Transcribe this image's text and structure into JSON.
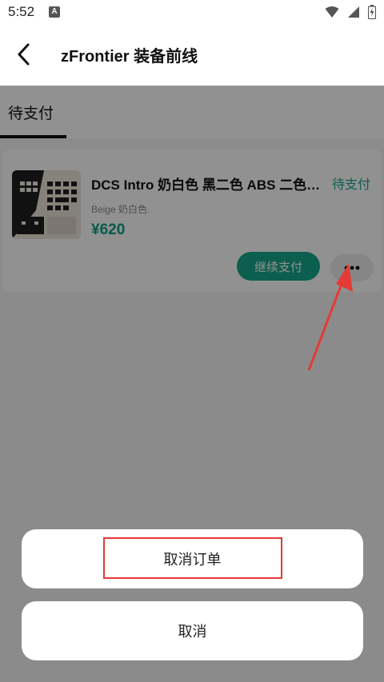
{
  "status_bar": {
    "time": "5:52",
    "notif_letter": "A"
  },
  "header": {
    "title": "zFrontier 装备前线"
  },
  "tabs": [
    {
      "label": "待支付",
      "active": true
    }
  ],
  "order": {
    "title": "DCS Intro 奶白色 黑二色 ABS 二色键帽",
    "status": "待支付",
    "variant": "Beige 奶白色",
    "price": "¥620",
    "pay_label": "继续支付",
    "more_icon": "ellipsis-icon"
  },
  "action_sheet": {
    "cancel_order_label": "取消订单",
    "cancel_label": "取消"
  },
  "colors": {
    "accent": "#16a589",
    "overlay": "rgba(0,0,0,0.43)",
    "annotation": "#e53935"
  }
}
